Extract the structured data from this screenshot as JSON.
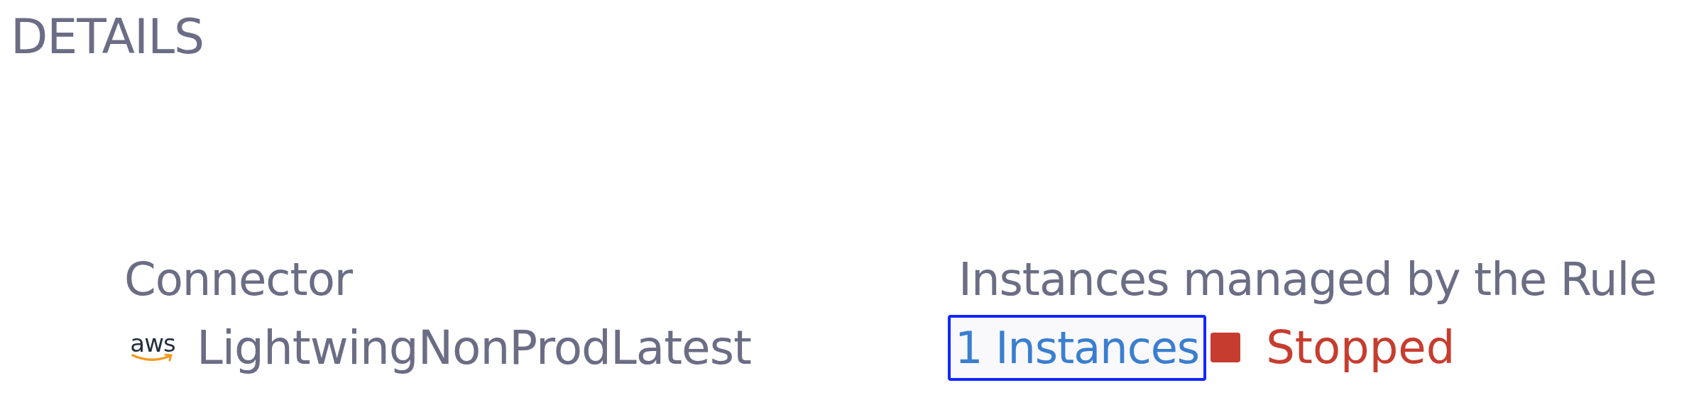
{
  "section_title": "DETAILS",
  "connector": {
    "label": "Connector",
    "logo": "aws",
    "name": "LightwingNonProdLatest"
  },
  "instances": {
    "label": "Instances managed by the Rule",
    "link": "1 Instances",
    "focused": true,
    "status": {
      "text": "Stopped",
      "color": "#c63d2f"
    }
  }
}
